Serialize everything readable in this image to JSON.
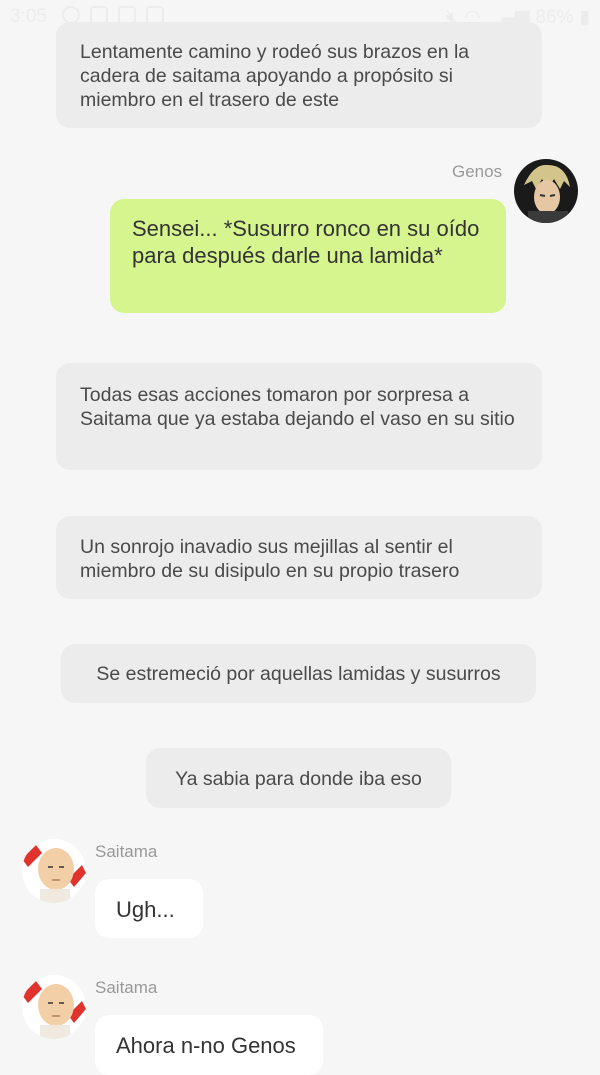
{
  "status_bar": {
    "time": "3:05",
    "battery": "86%"
  },
  "messages": [
    {
      "type": "narration",
      "text": "Lentamente camino y rodeó sus brazos en la cadera de saitama apoyando a propósito si miembro en el trasero de este"
    },
    {
      "type": "right",
      "sender": "Genos",
      "text": "Sensei... *Susurro ronco en su oído para después darle una lamida*"
    },
    {
      "type": "narration",
      "text": "Todas esas acciones tomaron por sorpresa a Saitama que ya estaba dejando el vaso en su sitio"
    },
    {
      "type": "narration",
      "text": "Un sonrojo inavadio sus mejillas al sentir el miembro de su disipulo en su propio trasero"
    },
    {
      "type": "narration",
      "text": "Se estremeció por aquellas lamidas y susurros"
    },
    {
      "type": "narration",
      "text": "Ya sabia para donde iba eso"
    },
    {
      "type": "left",
      "sender": "Saitama",
      "text": "Ugh..."
    },
    {
      "type": "left",
      "sender": "Saitama",
      "text": "Ahora n-no Genos"
    }
  ],
  "colors": {
    "background": "#f6f6f6",
    "narration_bubble": "#ececec",
    "sent_bubble": "#d6f58e",
    "received_bubble": "#ffffff",
    "name_text": "#999999"
  },
  "icons": [
    "whatsapp-icon",
    "bag-icon",
    "instagram-icon",
    "gallery-icon",
    "mute-icon",
    "wifi-icon",
    "signal-icon",
    "battery-icon"
  ]
}
